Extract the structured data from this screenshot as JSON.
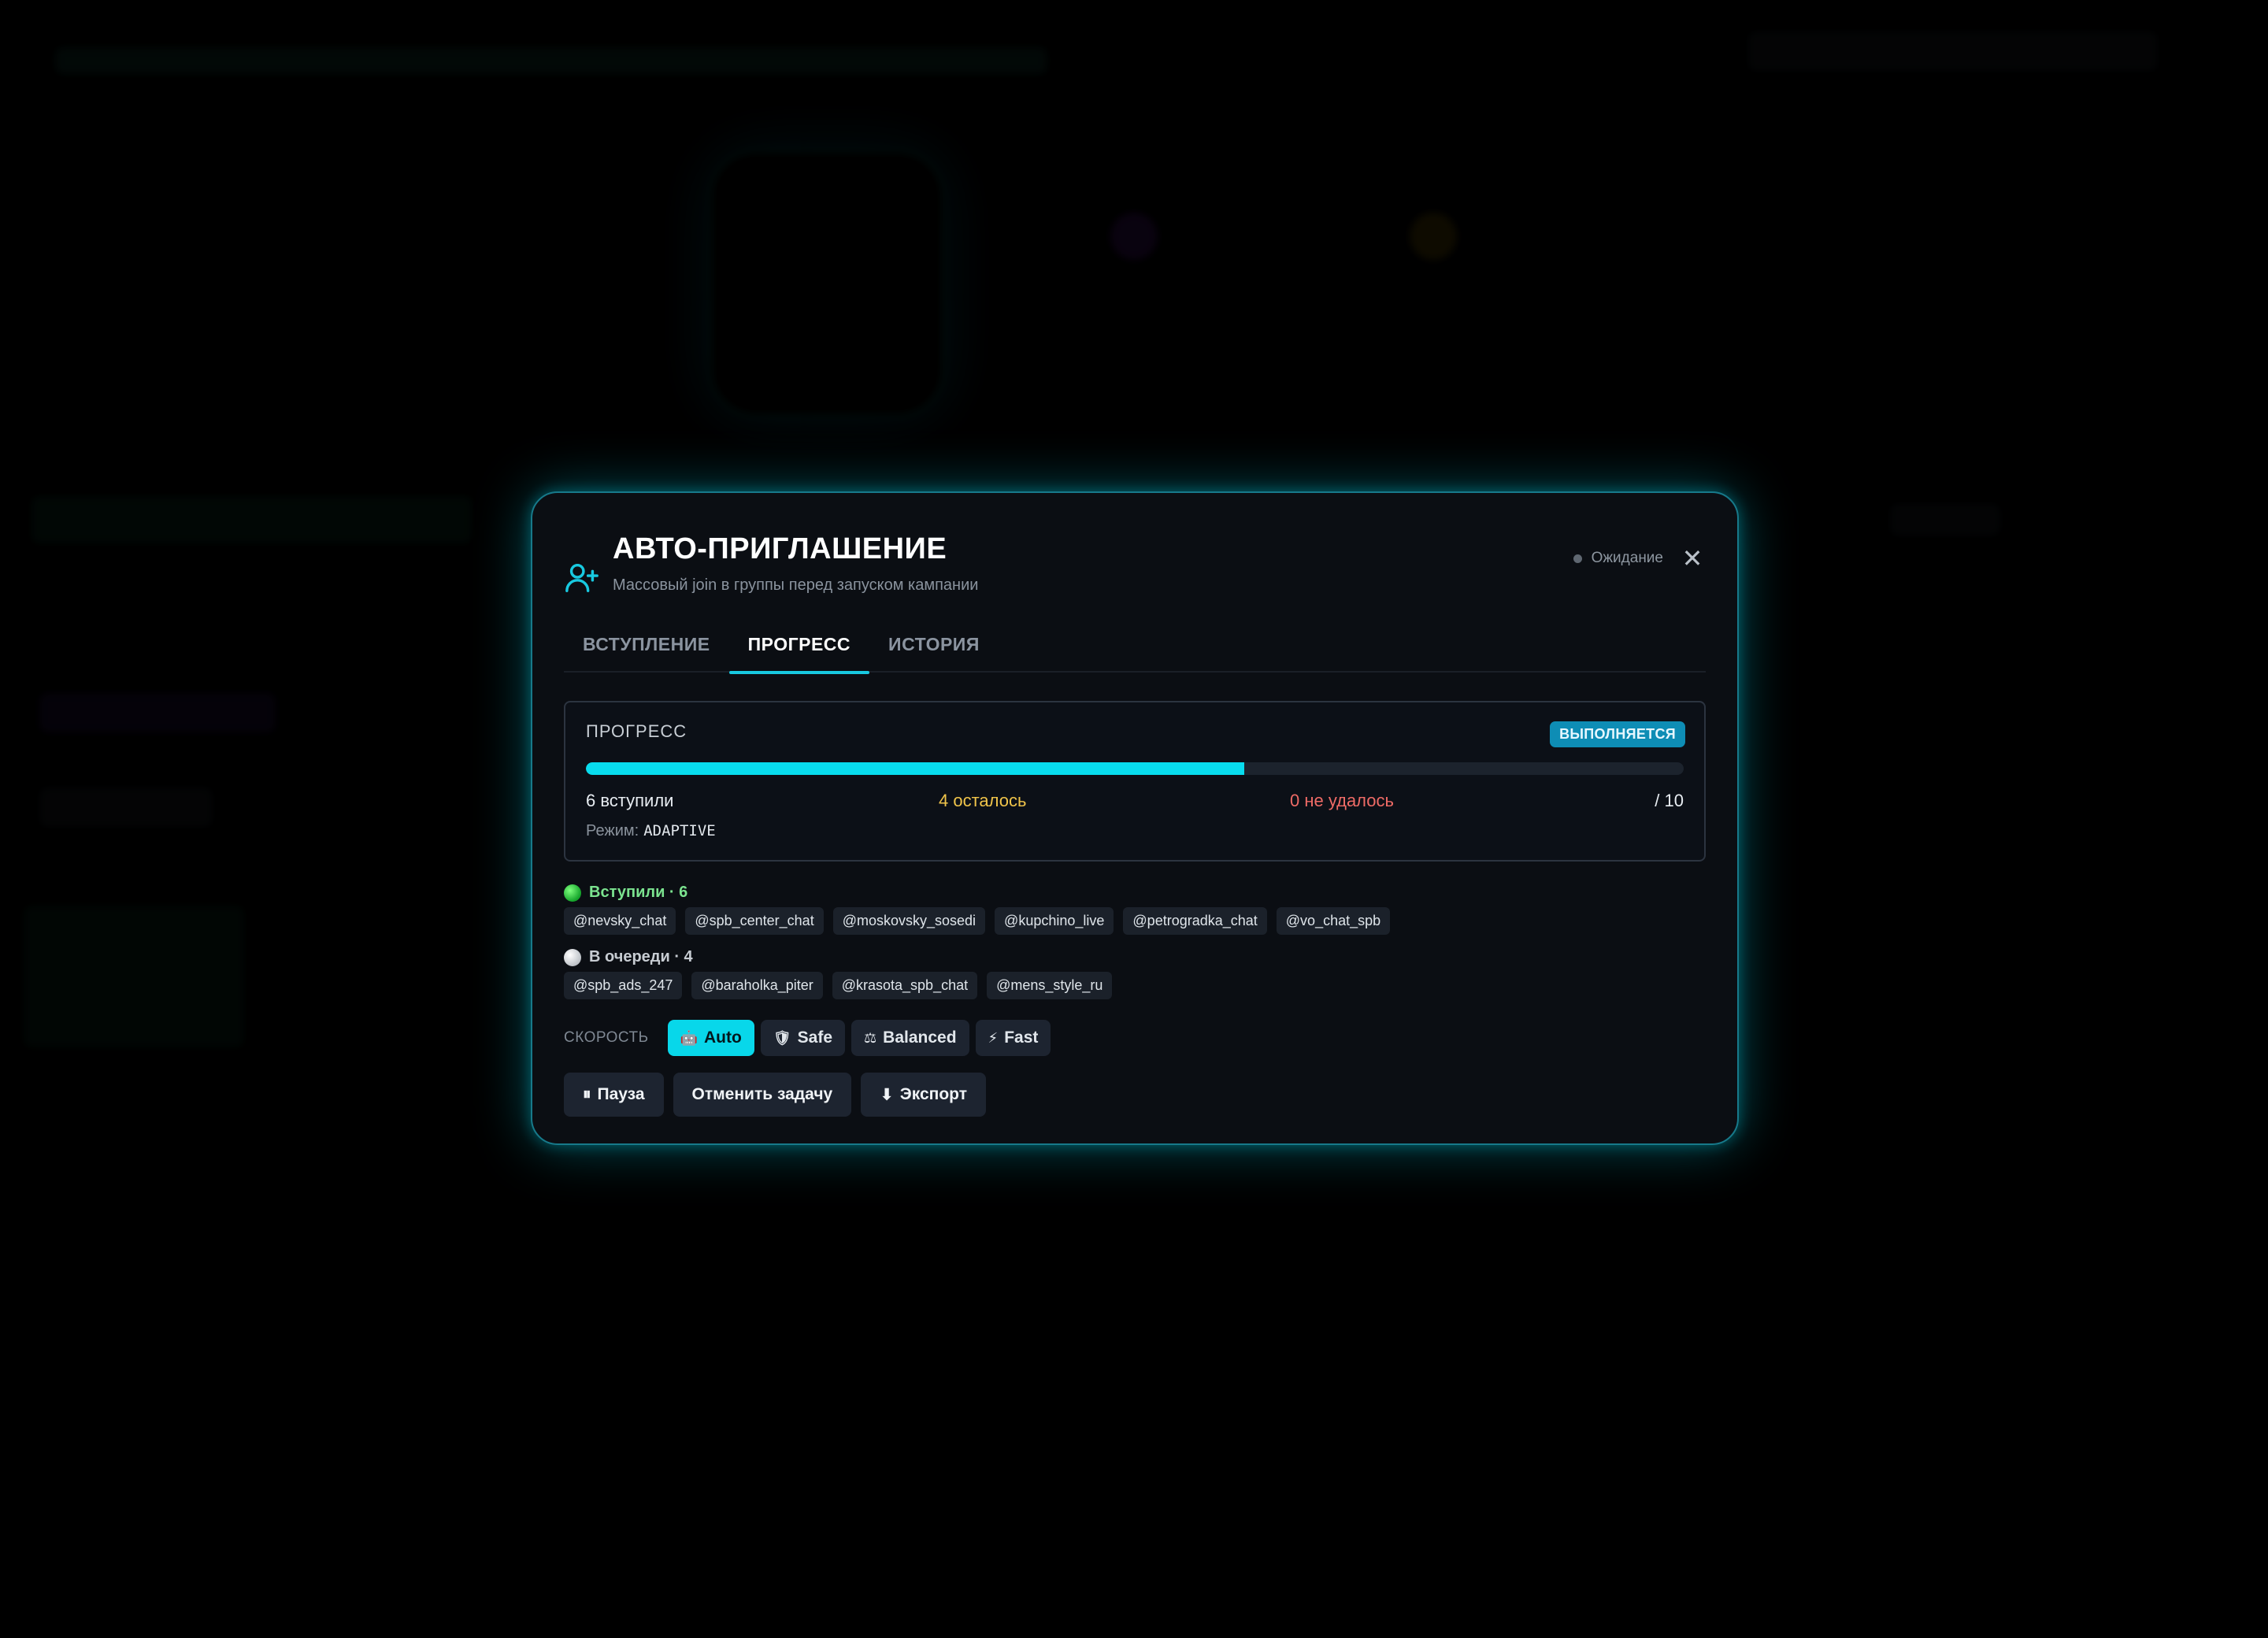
{
  "modal": {
    "title": "АВТО-ПРИГЛАШЕНИЕ",
    "subtitle": "Массовый join в группы перед запуском кампании",
    "status_text": "Ожидание",
    "close_glyph": "✕",
    "accent_color": "#08dcee"
  },
  "tabs": [
    {
      "label": "ВСТУПЛЕНИЕ",
      "active": false
    },
    {
      "label": "ПРОГРЕСС",
      "active": true
    },
    {
      "label": "ИСТОРИЯ",
      "active": false
    }
  ],
  "progress": {
    "label": "ПРОГРЕСС",
    "badge": "ВЫПОЛНЯЕТСЯ",
    "fraction": 0.6,
    "joined_text": "6 вступили",
    "left_text": "4 осталось",
    "failed_text": "0 не удалось",
    "total_text": "/ 10",
    "mode_label": "Режим:",
    "mode_value": "ADAPTIVE"
  },
  "groups": {
    "joined_header": "Вступили · 6",
    "joined": [
      "@nevsky_chat",
      "@spb_center_chat",
      "@moskovsky_sosedi",
      "@kupchino_live",
      "@petrogradka_chat",
      "@vo_chat_spb"
    ],
    "queue_header": "В очереди · 4",
    "queue": [
      "@spb_ads_247",
      "@baraholka_piter",
      "@krasota_spb_chat",
      "@mens_style_ru"
    ]
  },
  "speed": {
    "label": "СКОРОСТЬ",
    "options": [
      {
        "icon": "🤖",
        "label": "Auto",
        "active": true
      },
      {
        "icon": "🛡",
        "label": "Safe",
        "active": false
      },
      {
        "icon": "⚖",
        "label": "Balanced",
        "active": false
      },
      {
        "icon": "⚡",
        "label": "Fast",
        "active": false
      }
    ]
  },
  "actions": {
    "pause_icon": "⏸",
    "pause": "Пауза",
    "cancel": "Отменить задачу",
    "export_icon": "⬇",
    "export": "Экспорт"
  }
}
